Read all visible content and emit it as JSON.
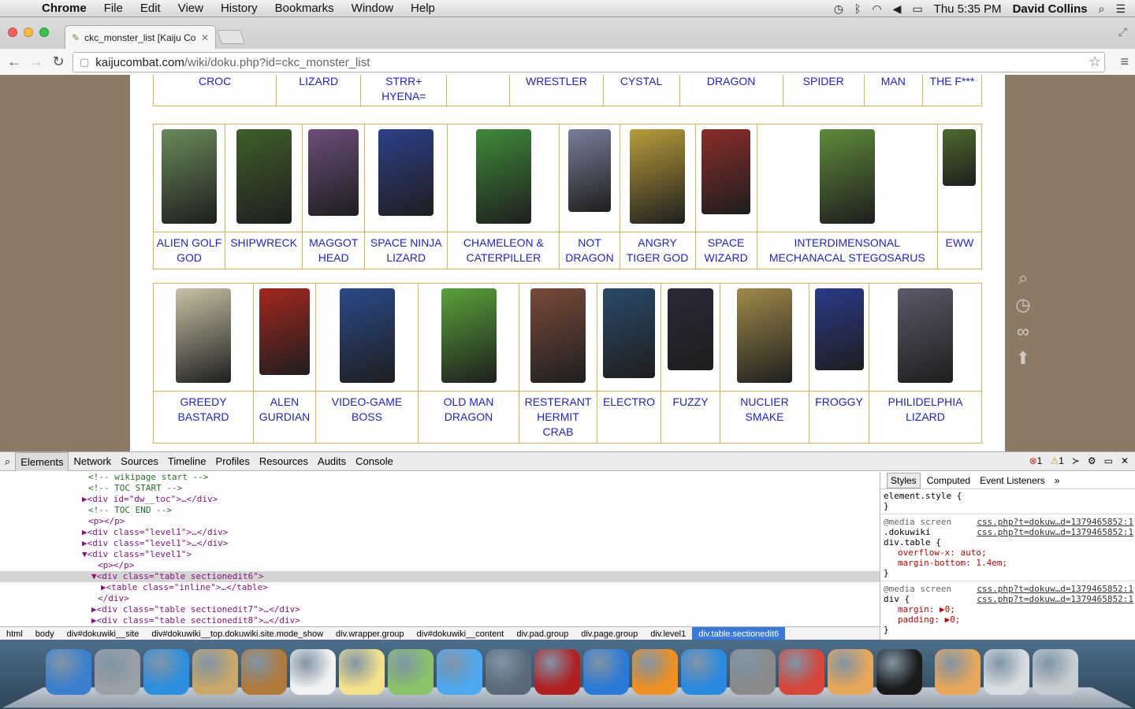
{
  "menubar": {
    "app": "Chrome",
    "menus": [
      "File",
      "Edit",
      "View",
      "History",
      "Bookmarks",
      "Window",
      "Help"
    ],
    "clock": "Thu 5:35 PM",
    "user": "David Collins"
  },
  "browser": {
    "tab_title": "ckc_monster_list [Kaiju Co",
    "url_host": "kaijucombat.com",
    "url_path": "/wiki/doku.php?id=ckc_monster_list"
  },
  "table_top_row": [
    "CROC",
    "LIZARD",
    "STRR+ HYENA=",
    "",
    "WRESTLER",
    "CYSTAL",
    "DRAGON",
    "SPIDER",
    "MAN",
    "THE F***"
  ],
  "table2": [
    {
      "label": "ALIEN GOLF GOD",
      "color": "#6a8a5a"
    },
    {
      "label": "SHIPWRECK",
      "color": "#3f5f2a"
    },
    {
      "label": "MAGGOT HEAD",
      "color": "#6b4e7a"
    },
    {
      "label": "SPACE NINJA LIZARD",
      "color": "#2d3f8a"
    },
    {
      "label": "CHAMELEON & CATERPILLER",
      "color": "#3f8a3a"
    },
    {
      "label": "NOT DRAGON",
      "color": "#7a7f9a"
    },
    {
      "label": "ANGRY TIGER GOD",
      "color": "#b99d3a"
    },
    {
      "label": "SPACE WIZARD",
      "color": "#8a2d2a"
    },
    {
      "label": "INTERDIMENSONAL MECHANACAL STEGOSARUS",
      "color": "#5f8a3a"
    },
    {
      "label": "EWW",
      "color": "#4e6b2d"
    }
  ],
  "table3": [
    {
      "label": "GREEDY BASTARD",
      "color": "#c9c1a5"
    },
    {
      "label": "ALEN GURDIAN",
      "color": "#a3271f"
    },
    {
      "label": "VIDEO-GAME BOSS",
      "color": "#2a4a8a"
    },
    {
      "label": "OLD MAN DRAGON",
      "color": "#5aa23a"
    },
    {
      "label": "RESTERANT HERMIT CRAB",
      "color": "#7a4a3a"
    },
    {
      "label": "ELECTRO",
      "color": "#2a4a6a"
    },
    {
      "label": "FUZZY",
      "color": "#2a2a3a"
    },
    {
      "label": "NUCLIER SMAKE",
      "color": "#a08a4a"
    },
    {
      "label": "FROGGY",
      "color": "#2a3a8a"
    },
    {
      "label": "PHILIDELPHIA LIZARD",
      "color": "#5a5a6a"
    }
  ],
  "devtools": {
    "tabs": [
      "Elements",
      "Network",
      "Sources",
      "Timeline",
      "Profiles",
      "Resources",
      "Audits",
      "Console"
    ],
    "errors": "1",
    "warnings": "1",
    "dom_lines": [
      {
        "text": "<!-- wikipage start -->",
        "cls": "cmt"
      },
      {
        "text": "<!-- TOC START -->",
        "cls": "cmt"
      },
      {
        "text": "▶<div id=\"dw__toc\">…</div>",
        "cls": "tag"
      },
      {
        "text": "<!-- TOC END -->",
        "cls": "cmt"
      },
      {
        "text": "<p></p>",
        "cls": "tag"
      },
      {
        "text": "▶<div class=\"level1\">…</div>",
        "cls": "tag"
      },
      {
        "text": "▶<div class=\"level1\">…</div>",
        "cls": "tag"
      },
      {
        "text": "▼<div class=\"level1\">",
        "cls": "tag"
      },
      {
        "text": "  <p></p>",
        "cls": "tag"
      },
      {
        "text": "  ▼<div class=\"table sectionedit6\">",
        "cls": "tag"
      },
      {
        "text": "    ▶<table class=\"inline\">…</table>",
        "cls": "tag"
      },
      {
        "text": "    </div>",
        "cls": "tag"
      },
      {
        "text": "  ▶<div class=\"table sectionedit7\">…</div>",
        "cls": "tag"
      },
      {
        "text": "  ▶<div class=\"table sectionedit8\">…</div>",
        "cls": "tag"
      }
    ],
    "breadcrumbs": [
      "html",
      "body",
      "div#dokuwiki__site",
      "div#dokuwiki__top.dokuwiki.site.mode_show",
      "div.wrapper.group",
      "div#dokuwiki__content",
      "div.pad.group",
      "div.page.group",
      "div.level1",
      "div.table.sectionedit6"
    ],
    "style_tabs": [
      "Styles",
      "Computed",
      "Event Listeners"
    ],
    "styles": [
      {
        "kind": "sel",
        "text": "element.style {"
      },
      {
        "kind": "sel",
        "text": "}"
      },
      {
        "kind": "sep"
      },
      {
        "kind": "media",
        "text": "@media screen",
        "src": "css.php?t=dokuw…d=1379465852:1"
      },
      {
        "kind": "sel",
        "text": ".dokuwiki",
        "src": "css.php?t=dokuw…d=1379465852:1"
      },
      {
        "kind": "sel",
        "text": "div.table {"
      },
      {
        "kind": "prop",
        "text": "overflow-x: auto;"
      },
      {
        "kind": "prop",
        "text": "margin-bottom: 1.4em;"
      },
      {
        "kind": "sel",
        "text": "}"
      },
      {
        "kind": "sep"
      },
      {
        "kind": "media",
        "text": "@media screen",
        "src": "css.php?t=dokuw…d=1379465852:1"
      },
      {
        "kind": "sel",
        "text": "div {",
        "src": "css.php?t=dokuw…d=1379465852:1"
      },
      {
        "kind": "prop",
        "text": "margin: ▶0;"
      },
      {
        "kind": "prop",
        "text": "padding: ▶0;"
      },
      {
        "kind": "sel",
        "text": "}"
      }
    ]
  },
  "dock_icons": [
    {
      "name": "finder-icon",
      "color": "#3a7fd0"
    },
    {
      "name": "launchpad-icon",
      "color": "#9aa0a8"
    },
    {
      "name": "safari-icon",
      "color": "#2c8fe0"
    },
    {
      "name": "mail-icon",
      "color": "#c9a86a"
    },
    {
      "name": "contacts-icon",
      "color": "#b07a3a"
    },
    {
      "name": "calendar-icon",
      "color": "#f2f2f2"
    },
    {
      "name": "notes-icon",
      "color": "#f3e28a"
    },
    {
      "name": "maps-icon",
      "color": "#8ac36a"
    },
    {
      "name": "messages-icon",
      "color": "#4ea8f0"
    },
    {
      "name": "facetime-icon",
      "color": "#5a6a7a"
    },
    {
      "name": "photobooth-icon",
      "color": "#b02020"
    },
    {
      "name": "itunes-icon",
      "color": "#2a7ad8"
    },
    {
      "name": "ibooks-icon",
      "color": "#f09020"
    },
    {
      "name": "appstore-icon",
      "color": "#2a8ae0"
    },
    {
      "name": "system-preferences-icon",
      "color": "#8a8a8a"
    },
    {
      "name": "chrome-icon",
      "color": "#d8453a"
    },
    {
      "name": "github-icon",
      "color": "#e8a85a"
    },
    {
      "name": "brackets-icon",
      "color": "#1a1a1a"
    },
    {
      "name": "github-for-mac-icon",
      "color": "#e8a85a"
    },
    {
      "name": "screenshot-stack-icon",
      "color": "#d8dde2"
    },
    {
      "name": "trash-icon",
      "color": "#c8cdd2"
    }
  ]
}
